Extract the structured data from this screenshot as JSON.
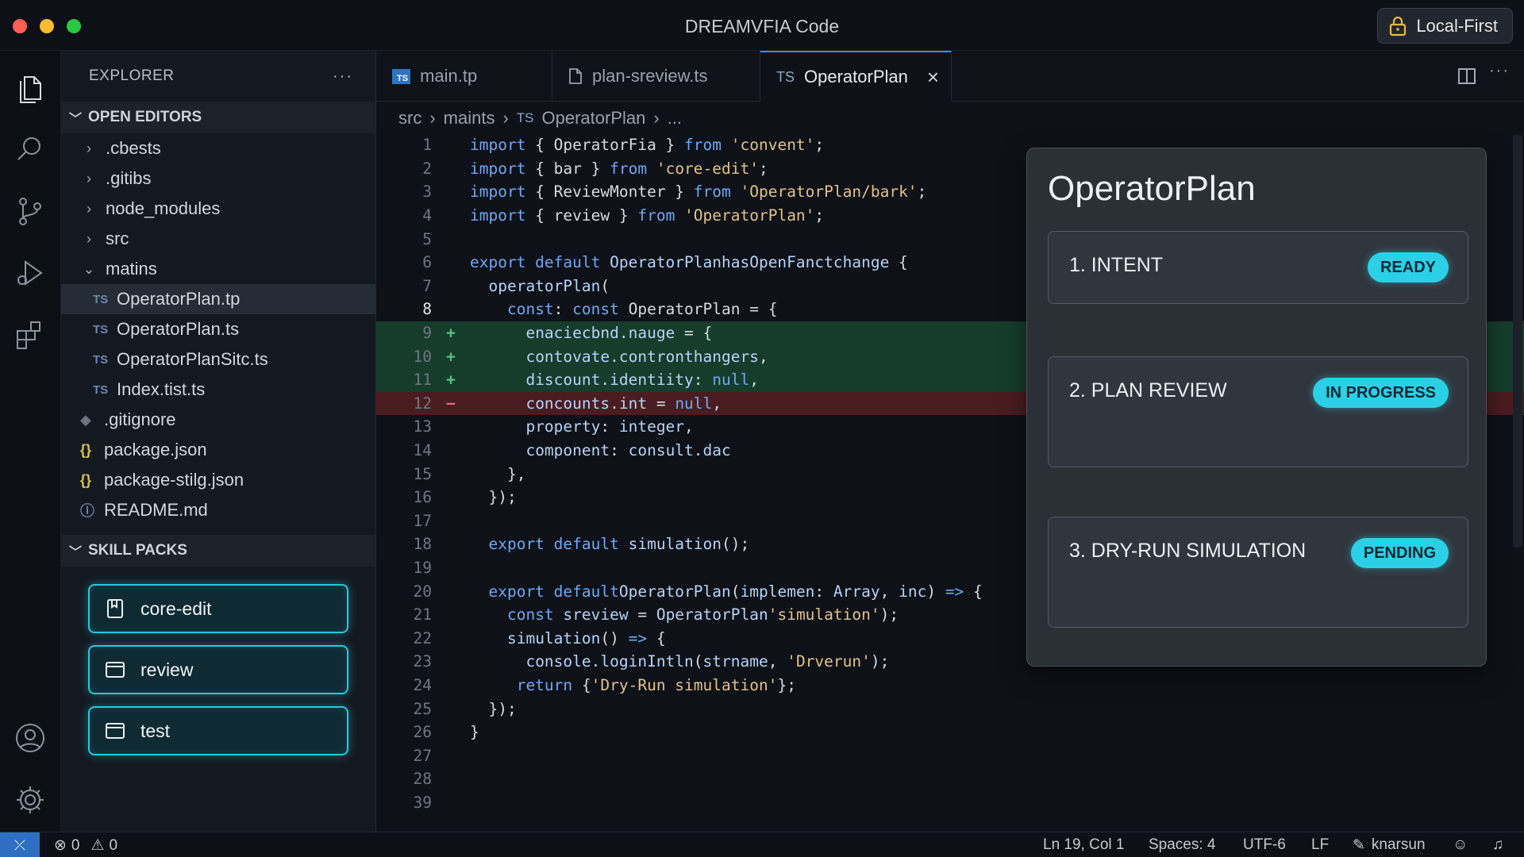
{
  "window": {
    "title": "DREAMVFIA Code",
    "badge_label": "Local-First",
    "badge_icon": "lock-icon",
    "traffic_colors": [
      "#ff5f57",
      "#febc2e",
      "#28c840"
    ]
  },
  "activity_bar": {
    "items": [
      "files-icon",
      "search-icon",
      "source-control-icon",
      "run-debug-icon",
      "extensions-icon"
    ],
    "bottom": [
      "account-icon",
      "gear-icon"
    ]
  },
  "sidebar": {
    "title": "EXPLORER",
    "more": "···",
    "open_editors_label": "OPEN EDITORS",
    "tree": [
      {
        "label": ".cbests",
        "kind": "folder",
        "expanded": false
      },
      {
        "label": ".gitibs",
        "kind": "folder",
        "expanded": false
      },
      {
        "label": "node_modules",
        "kind": "folder",
        "expanded": false
      },
      {
        "label": "src",
        "kind": "folder",
        "expanded": false
      },
      {
        "label": "matins",
        "kind": "folder",
        "expanded": true
      },
      {
        "label": "OperatorPlan.tp",
        "kind": "ts",
        "icon": "TS",
        "selected": true
      },
      {
        "label": "OperatorPlan.ts",
        "kind": "ts",
        "icon": "TS"
      },
      {
        "label": "OperatorPlanSitc.ts",
        "kind": "ts",
        "icon": "TS"
      },
      {
        "label": "Index.tist.ts",
        "kind": "ts",
        "icon": "TS"
      },
      {
        "label": ".gitignore",
        "kind": "git",
        "icon": "◆"
      },
      {
        "label": "package.json",
        "kind": "json",
        "icon": "{}"
      },
      {
        "label": "package-stilg.json",
        "kind": "json",
        "icon": "{}"
      },
      {
        "label": "README.md",
        "kind": "info",
        "icon": "ⓘ"
      }
    ],
    "skill_packs_label": "SKILL PACKS",
    "skill_packs": [
      {
        "label": "core-edit",
        "icon": "bookmark-icon"
      },
      {
        "label": "review",
        "icon": "window-icon"
      },
      {
        "label": "test",
        "icon": "window-icon"
      }
    ]
  },
  "tabs": [
    {
      "label": "main.tp",
      "icon": "TS",
      "active": false
    },
    {
      "label": "plan-sreview.ts",
      "icon": "file-icon",
      "active": false
    },
    {
      "label": "OperatorPlan",
      "icon": "TS",
      "active": true,
      "close": "×"
    }
  ],
  "breadcrumb": [
    "src",
    "maints",
    "OperatorPlan",
    "..."
  ],
  "breadcrumb_ts_badge": "TS",
  "editor": {
    "lines": [
      {
        "n": "1",
        "parts": [
          [
            "kw",
            "import"
          ],
          [
            "pl",
            " { OperatorFia } "
          ],
          [
            "kw",
            "from"
          ],
          [
            "str",
            " 'convent'"
          ],
          [
            "pl",
            ";"
          ]
        ]
      },
      {
        "n": "2",
        "parts": [
          [
            "kw",
            "import"
          ],
          [
            "pl",
            " { bar } "
          ],
          [
            "kw",
            "from"
          ],
          [
            "str",
            " 'core-edit'"
          ],
          [
            "pl",
            ";"
          ]
        ]
      },
      {
        "n": "3",
        "parts": [
          [
            "kw",
            "import"
          ],
          [
            "pl",
            " { ReviewMonter } "
          ],
          [
            "kw",
            "from"
          ],
          [
            "str",
            " 'OperatorPlan/bark'"
          ],
          [
            "pl",
            ";"
          ]
        ]
      },
      {
        "n": "4",
        "parts": [
          [
            "kw",
            "import"
          ],
          [
            "pl",
            " { review } "
          ],
          [
            "kw",
            "from"
          ],
          [
            "str",
            " 'OperatorPlan'"
          ],
          [
            "pl",
            ";"
          ]
        ]
      },
      {
        "n": "5",
        "parts": []
      },
      {
        "n": "6",
        "parts": [
          [
            "kw",
            "export default "
          ],
          [
            "fn",
            "OperatorPlanhasOpenFanctchange"
          ],
          [
            "pl",
            " {"
          ]
        ]
      },
      {
        "n": "7",
        "parts": [
          [
            "pl",
            "  "
          ],
          [
            "fn",
            "operatorPlan"
          ],
          [
            "pl",
            "("
          ]
        ]
      },
      {
        "n": "8",
        "state": "current",
        "parts": [
          [
            "pl",
            "    "
          ],
          [
            "kw",
            "const"
          ],
          [
            "pl",
            ": "
          ],
          [
            "kw",
            "const"
          ],
          [
            "pl",
            " OperatorPlan = {"
          ]
        ]
      },
      {
        "n": "9",
        "state": "added",
        "parts": [
          [
            "pl",
            "      "
          ],
          [
            "fn",
            "enaciecbnd.nauge"
          ],
          [
            "pl",
            " = {"
          ]
        ]
      },
      {
        "n": "10",
        "state": "added",
        "parts": [
          [
            "pl",
            "      "
          ],
          [
            "fn",
            "contovate.contronthangers"
          ],
          [
            "pl",
            ","
          ]
        ]
      },
      {
        "n": "11",
        "state": "added",
        "parts": [
          [
            "pl",
            "      "
          ],
          [
            "fn",
            "discount.identiity"
          ],
          [
            "pl",
            ": "
          ],
          [
            "kw",
            "null"
          ],
          [
            "pl",
            ","
          ]
        ]
      },
      {
        "n": "12",
        "state": "removed",
        "parts": [
          [
            "pl",
            "      "
          ],
          [
            "fn",
            "concounts.int"
          ],
          [
            "pl",
            " = "
          ],
          [
            "kw",
            "null"
          ],
          [
            "pl",
            ","
          ]
        ]
      },
      {
        "n": "13",
        "parts": [
          [
            "pl",
            "      "
          ],
          [
            "fn",
            "property"
          ],
          [
            "pl",
            ": "
          ],
          [
            "fn",
            "integer"
          ],
          [
            "pl",
            ","
          ]
        ]
      },
      {
        "n": "14",
        "parts": [
          [
            "pl",
            "      "
          ],
          [
            "fn",
            "component"
          ],
          [
            "pl",
            ": "
          ],
          [
            "fn",
            "consult.dac"
          ]
        ]
      },
      {
        "n": "15",
        "parts": [
          [
            "pl",
            "    },"
          ]
        ]
      },
      {
        "n": "16",
        "parts": [
          [
            "pl",
            "  });"
          ]
        ]
      },
      {
        "n": "17",
        "parts": []
      },
      {
        "n": "18",
        "parts": [
          [
            "pl",
            "  "
          ],
          [
            "kw",
            "export default "
          ],
          [
            "fn",
            "simulation"
          ],
          [
            "pl",
            "();"
          ]
        ]
      },
      {
        "n": "19",
        "parts": []
      },
      {
        "n": "20",
        "parts": [
          [
            "pl",
            "  "
          ],
          [
            "kw",
            "export default"
          ],
          [
            "fn",
            "OperatorPlan"
          ],
          [
            "pl",
            "("
          ],
          [
            "fn",
            "implemen"
          ],
          [
            "pl",
            ": "
          ],
          [
            "fn",
            "Array"
          ],
          [
            "pl",
            ", "
          ],
          [
            "fn",
            "inc"
          ],
          [
            "pl",
            ") "
          ],
          [
            "kw",
            "=>"
          ],
          [
            "pl",
            " {"
          ]
        ]
      },
      {
        "n": "21",
        "parts": [
          [
            "pl",
            "    "
          ],
          [
            "kw",
            "const"
          ],
          [
            "fn",
            " sreview"
          ],
          [
            "pl",
            " = "
          ],
          [
            "fn",
            "OperatorPlan"
          ],
          [
            "str",
            "'simulation'"
          ],
          [
            "pl",
            ");"
          ]
        ]
      },
      {
        "n": "22",
        "parts": [
          [
            "pl",
            "    "
          ],
          [
            "fn",
            "simulation"
          ],
          [
            "pl",
            "() "
          ],
          [
            "kw",
            "=>"
          ],
          [
            "pl",
            " {"
          ]
        ]
      },
      {
        "n": "23",
        "parts": [
          [
            "pl",
            "      "
          ],
          [
            "fn",
            "console.loginIntln"
          ],
          [
            "pl",
            "("
          ],
          [
            "fn",
            "strname"
          ],
          [
            "pl",
            ", "
          ],
          [
            "str",
            "'Drverun'"
          ],
          [
            "pl",
            ");"
          ]
        ]
      },
      {
        "n": "24",
        "parts": [
          [
            "pl",
            "     "
          ],
          [
            "kw",
            "return"
          ],
          [
            "pl",
            " {"
          ],
          [
            "str",
            "'Dry-Run simulation'"
          ],
          [
            "pl",
            "};"
          ]
        ]
      },
      {
        "n": "25",
        "parts": [
          [
            "pl",
            "  });"
          ]
        ]
      },
      {
        "n": "26",
        "parts": [
          [
            "pl",
            "}"
          ]
        ]
      },
      {
        "n": "27",
        "parts": []
      },
      {
        "n": "28",
        "parts": []
      },
      {
        "n": "39",
        "parts": []
      }
    ]
  },
  "plan_card": {
    "title": "OperatorPlan",
    "stages": [
      {
        "label": "1. INTENT",
        "status": "READY"
      },
      {
        "label": "2. PLAN REVIEW",
        "status": "IN PROGRESS"
      },
      {
        "label": "3. DRY-RUN SIMULATION",
        "status": "PENDING"
      }
    ]
  },
  "status_bar": {
    "errors": "0",
    "warnings": "0",
    "position": "Ln 19, Col 1",
    "spaces": "Spaces: 4",
    "encoding": "UTF-6",
    "eol": "LF",
    "user": "knarsun"
  }
}
